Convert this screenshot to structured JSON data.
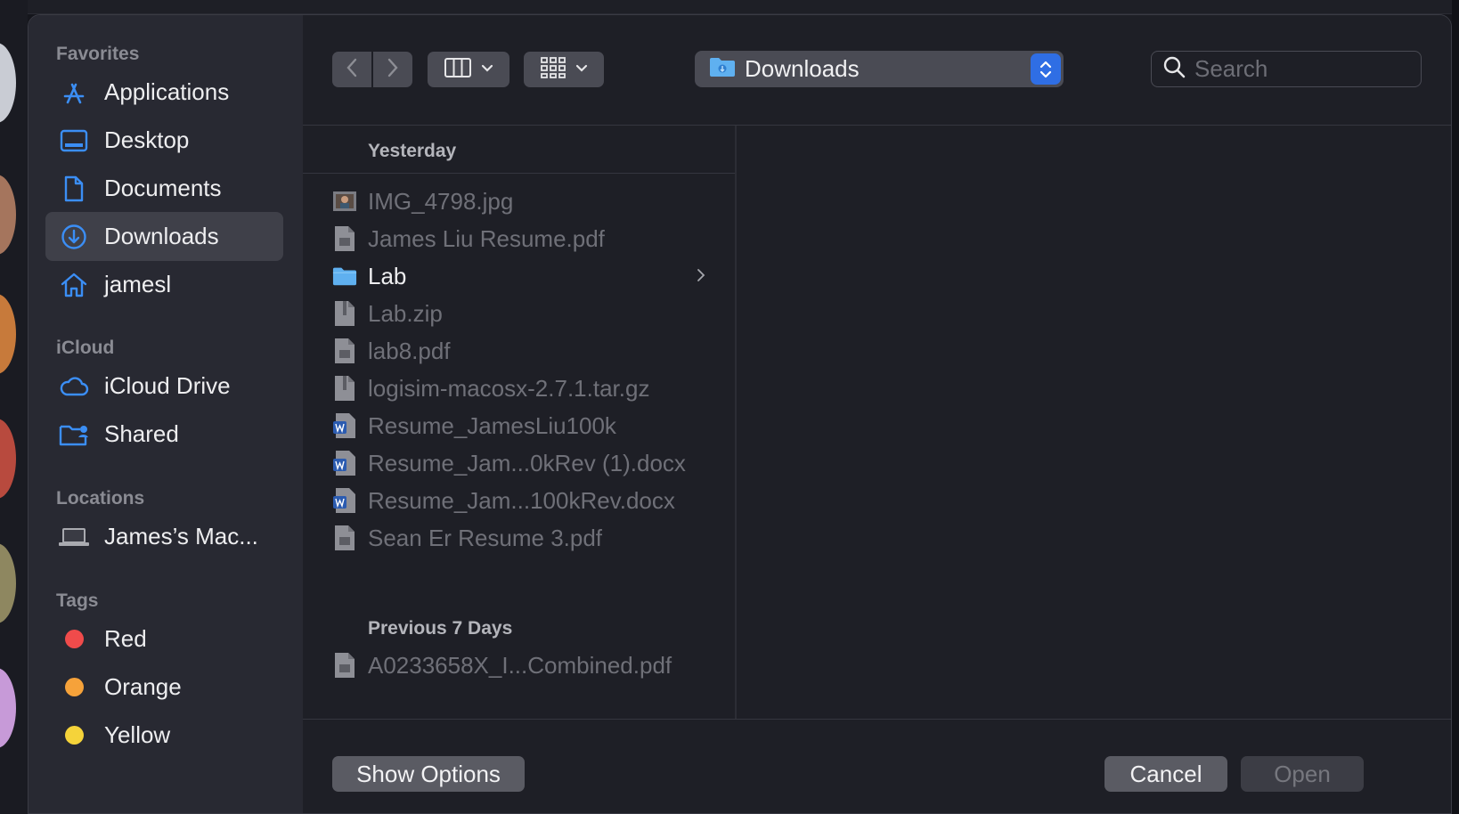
{
  "colors": {
    "accent": "#2f6ee4",
    "sidebar_icon": "#3b8ef5",
    "tag_red": "#f04b4b",
    "tag_orange": "#f6a23a",
    "tag_yellow": "#f5d33a"
  },
  "sidebar": {
    "sections": [
      {
        "title": "Favorites",
        "items": [
          {
            "label": "Applications",
            "icon": "applications-icon"
          },
          {
            "label": "Desktop",
            "icon": "desktop-icon"
          },
          {
            "label": "Documents",
            "icon": "documents-icon"
          },
          {
            "label": "Downloads",
            "icon": "downloads-icon",
            "selected": true
          },
          {
            "label": "jamesl",
            "icon": "home-icon"
          }
        ]
      },
      {
        "title": "iCloud",
        "items": [
          {
            "label": "iCloud Drive",
            "icon": "cloud-icon"
          },
          {
            "label": "Shared",
            "icon": "shared-folder-icon"
          }
        ]
      },
      {
        "title": "Locations",
        "items": [
          {
            "label": "James’s Mac...",
            "icon": "laptop-icon"
          }
        ]
      },
      {
        "title": "Tags",
        "items": [
          {
            "label": "Red",
            "icon": "red-tag-dot"
          },
          {
            "label": "Orange",
            "icon": "orange-tag-dot"
          },
          {
            "label": "Yellow",
            "icon": "yellow-tag-dot"
          }
        ]
      }
    ]
  },
  "toolbar": {
    "back_icon": "chevron-left-icon",
    "forward_icon": "chevron-right-icon",
    "view_icon": "column-view-icon",
    "group_icon": "group-by-icon",
    "location": "Downloads",
    "search_placeholder": "Search"
  },
  "files": {
    "groups": [
      {
        "title": "Yesterday",
        "items": [
          {
            "name": "IMG_4798.jpg",
            "type": "image",
            "enabled": false
          },
          {
            "name": "James Liu Resume.pdf",
            "type": "pdf",
            "enabled": false
          },
          {
            "name": "Lab",
            "type": "folder",
            "enabled": true
          },
          {
            "name": "Lab.zip",
            "type": "archive",
            "enabled": false
          },
          {
            "name": "lab8.pdf",
            "type": "pdf",
            "enabled": false
          },
          {
            "name": "logisim-macosx-2.7.1.tar.gz",
            "type": "archive",
            "enabled": false
          },
          {
            "name": "Resume_JamesLiu100k",
            "type": "word",
            "enabled": false
          },
          {
            "name": "Resume_Jam...0kRev (1).docx",
            "type": "word",
            "enabled": false
          },
          {
            "name": "Resume_Jam...100kRev.docx",
            "type": "word",
            "enabled": false
          },
          {
            "name": "Sean Er Resume 3.pdf",
            "type": "pdf",
            "enabled": false
          }
        ]
      },
      {
        "title": "Previous 7 Days",
        "items": [
          {
            "name": "A0233658X_I...Combined.pdf",
            "type": "pdf",
            "enabled": false
          }
        ]
      }
    ]
  },
  "footer": {
    "show_options": "Show Options",
    "cancel": "Cancel",
    "open": "Open"
  }
}
